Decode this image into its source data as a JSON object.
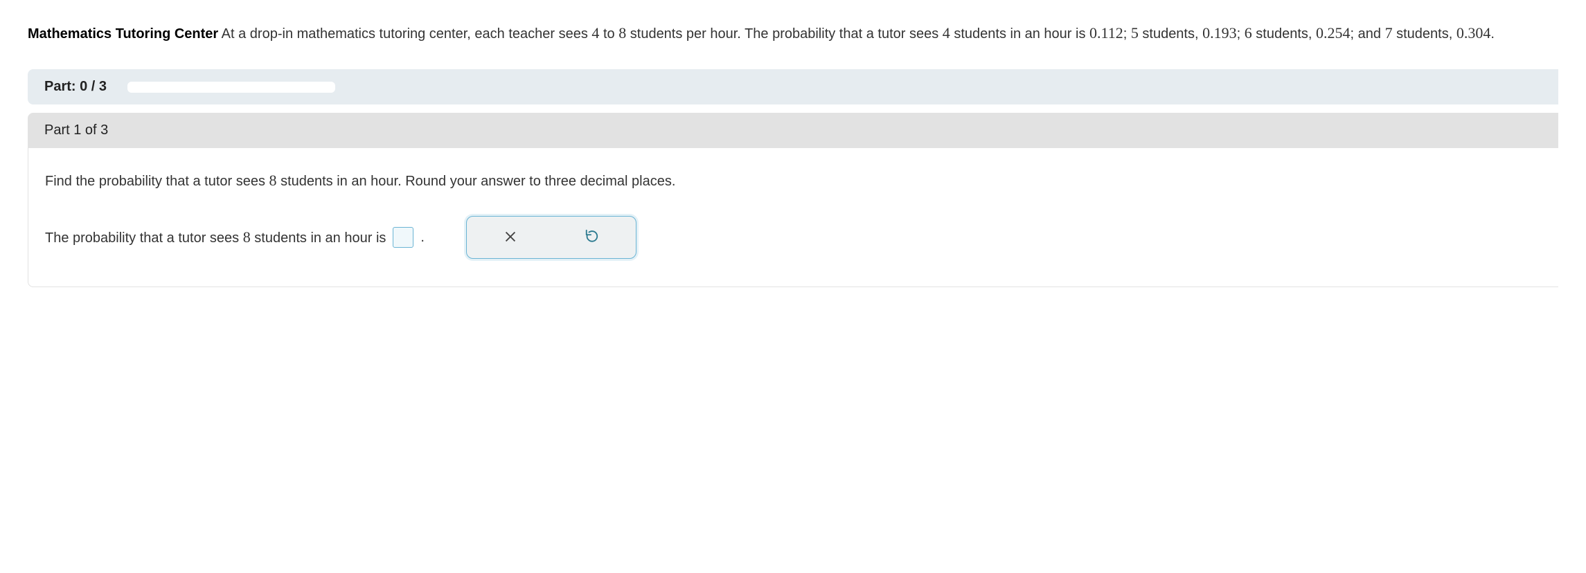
{
  "problem": {
    "title": "Mathematics Tutoring Center",
    "text_part1": " At a drop-in mathematics tutoring center, each teacher sees ",
    "num1": "4",
    "text_part2": " to ",
    "num2": "8",
    "text_part3": " students per hour. The probability that a tutor sees ",
    "num3": "4",
    "text_part4": " students in an hour is ",
    "prob1": "0.112",
    "text_part5": "; ",
    "num4": "5",
    "text_part6": " students, ",
    "prob2": "0.193",
    "text_part7": "; ",
    "num5": "6",
    "text_part8": " students, ",
    "prob3": "0.254",
    "text_part9": "; and ",
    "num6": "7",
    "text_part10": " students, ",
    "prob4": "0.304",
    "text_part11": "."
  },
  "progress": {
    "label": "Part: 0 / 3"
  },
  "part": {
    "header": "Part 1 of 3",
    "instruction_a": "Find the probability that a tutor sees ",
    "instruction_num": "8",
    "instruction_b": " students in an hour. Round your answer to three decimal places.",
    "answer_a": "The probability that a tutor sees ",
    "answer_num": "8",
    "answer_b": " students in an hour is ",
    "period": "."
  }
}
